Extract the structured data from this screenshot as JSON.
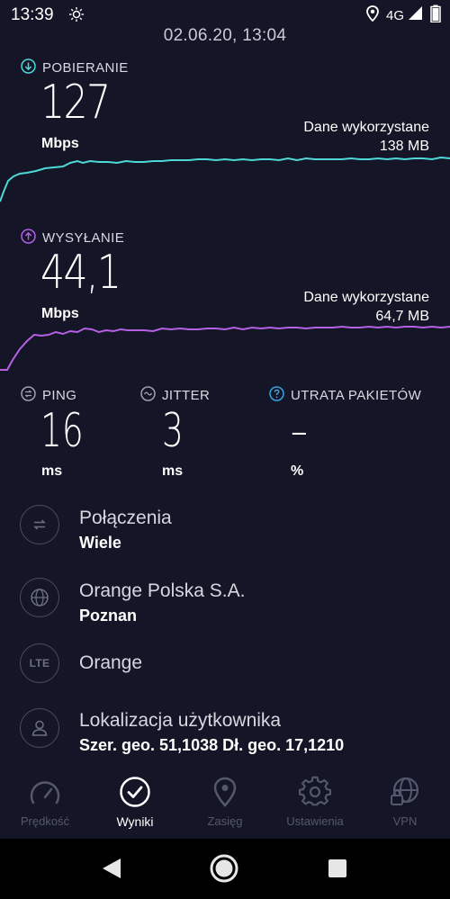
{
  "status_bar": {
    "time": "13:39",
    "network": "4G",
    "icons": [
      "brightness-icon",
      "location-icon",
      "signal-icon",
      "battery-icon"
    ]
  },
  "result_datetime": "02.06.20, 13:04",
  "download": {
    "label": "POBIERANIE",
    "value": "127",
    "unit": "Mbps",
    "data_used_label": "Dane wykorzystane",
    "data_used_value": "138 MB",
    "color": "#4fd8d8"
  },
  "upload": {
    "label": "WYSYŁANIE",
    "value": "44,1",
    "unit": "Mbps",
    "data_used_label": "Dane wykorzystane",
    "data_used_value": "64,7 MB",
    "color": "#b660e6"
  },
  "ping": {
    "label": "PING",
    "value": "16",
    "unit": "ms"
  },
  "jitter": {
    "label": "JITTER",
    "value": "3",
    "unit": "ms"
  },
  "packet_loss": {
    "label": "UTRATA PAKIETÓW",
    "value": "–",
    "unit": "%"
  },
  "info": {
    "connections": {
      "title": "Połączenia",
      "value": "Wiele",
      "icon": "connections-icon"
    },
    "provider": {
      "title": "Orange Polska S.A.",
      "value": "Poznan",
      "icon": "globe-icon"
    },
    "network": {
      "title": "Orange",
      "icon_text": "LTE",
      "icon": "lte-icon"
    },
    "location": {
      "title": "Lokalizacja użytkownika",
      "value": "Szer. geo. 51,1038 Dł. geo. 17,1210",
      "icon": "user-icon"
    }
  },
  "bottom_nav": [
    {
      "label": "Prędkość",
      "icon": "speedometer-icon",
      "active": false
    },
    {
      "label": "Wyniki",
      "icon": "checkmark-circle-icon",
      "active": true
    },
    {
      "label": "Zasięg",
      "icon": "map-pin-icon",
      "active": false
    },
    {
      "label": "Ustawienia",
      "icon": "gear-icon",
      "active": false
    },
    {
      "label": "VPN",
      "icon": "vpn-globe-lock-icon",
      "active": false
    }
  ],
  "colors": {
    "background": "#141526",
    "download_accent": "#4fd8d8",
    "upload_accent": "#b660e6",
    "info_accent": "#3aa3e0",
    "inactive_nav": "#55586d"
  }
}
